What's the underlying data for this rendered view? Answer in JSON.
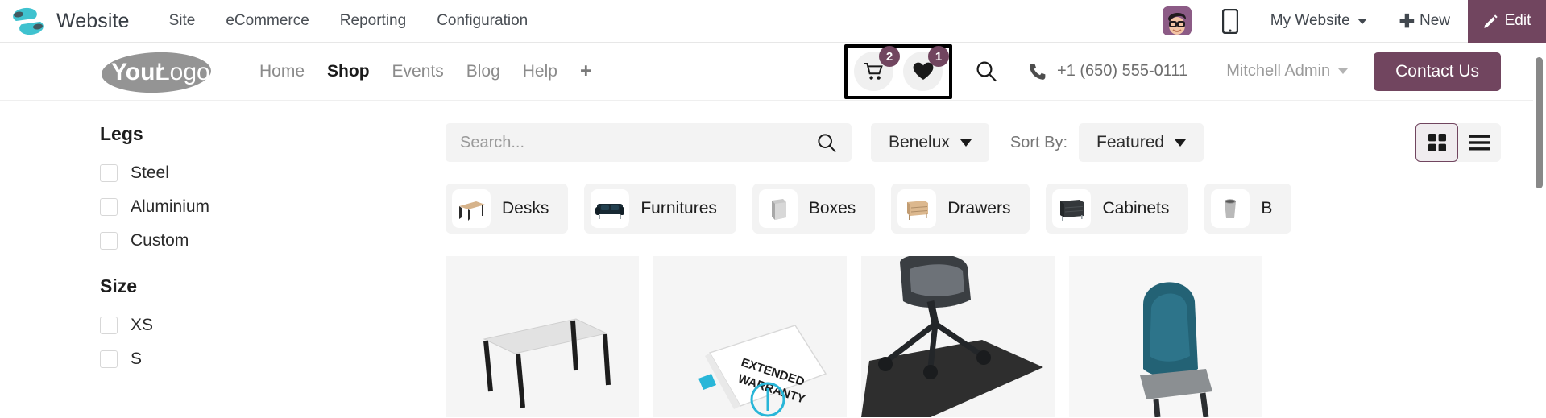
{
  "backend": {
    "app_name": "Website",
    "menus": [
      "Site",
      "eCommerce",
      "Reporting",
      "Configuration"
    ],
    "avatar_name": "user-avatar",
    "mobile_preview_icon": "mobile-phone-icon",
    "website_selector": "My Website",
    "new_label": "New",
    "edit_label": "Edit",
    "accent_color": "#71455f"
  },
  "site_header": {
    "logo_text_bold": "Your",
    "logo_text_light": "Logo",
    "nav": [
      {
        "label": "Home",
        "active": false
      },
      {
        "label": "Shop",
        "active": true
      },
      {
        "label": "Events",
        "active": false
      },
      {
        "label": "Blog",
        "active": false
      },
      {
        "label": "Help",
        "active": false
      }
    ],
    "add_menu_glyph": "+",
    "cart": {
      "icon": "shopping-cart-icon",
      "count": "2"
    },
    "wishlist": {
      "icon": "heart-icon",
      "count": "1"
    },
    "search_icon": "search-icon",
    "phone_icon": "phone-icon",
    "phone": "+1 (650) 555-0111",
    "user_name": "Mitchell Admin",
    "contact_label": "Contact Us"
  },
  "filters": [
    {
      "title": "Legs",
      "options": [
        {
          "label": "Steel",
          "checked": false
        },
        {
          "label": "Aluminium",
          "checked": false
        },
        {
          "label": "Custom",
          "checked": false
        }
      ]
    },
    {
      "title": "Size",
      "options": [
        {
          "label": "XS",
          "checked": false
        },
        {
          "label": "S",
          "checked": false
        }
      ]
    }
  ],
  "toolbar": {
    "search_placeholder": "Search...",
    "search_value": "",
    "search_icon": "search-icon",
    "region_filter": "Benelux",
    "sort_by_label": "Sort By:",
    "sort_value": "Featured",
    "view_grid_icon": "grid-view-icon",
    "view_list_icon": "list-view-icon",
    "active_view": "grid"
  },
  "categories": [
    {
      "label": "Desks",
      "thumb": "desk-thumbnail"
    },
    {
      "label": "Furnitures",
      "thumb": "sofa-thumbnail"
    },
    {
      "label": "Boxes",
      "thumb": "box-thumbnail"
    },
    {
      "label": "Drawers",
      "thumb": "drawer-thumbnail"
    },
    {
      "label": "Cabinets",
      "thumb": "cabinet-thumbnail"
    },
    {
      "label": "B",
      "thumb": "bin-thumbnail"
    }
  ],
  "products": [
    {
      "name": "office-desk-image",
      "caption": ""
    },
    {
      "name": "extended-warranty-image",
      "caption": "EXTENDED WARRANTY"
    },
    {
      "name": "office-chair-on-mat-image",
      "caption": ""
    },
    {
      "name": "teal-chair-image",
      "caption": ""
    }
  ]
}
